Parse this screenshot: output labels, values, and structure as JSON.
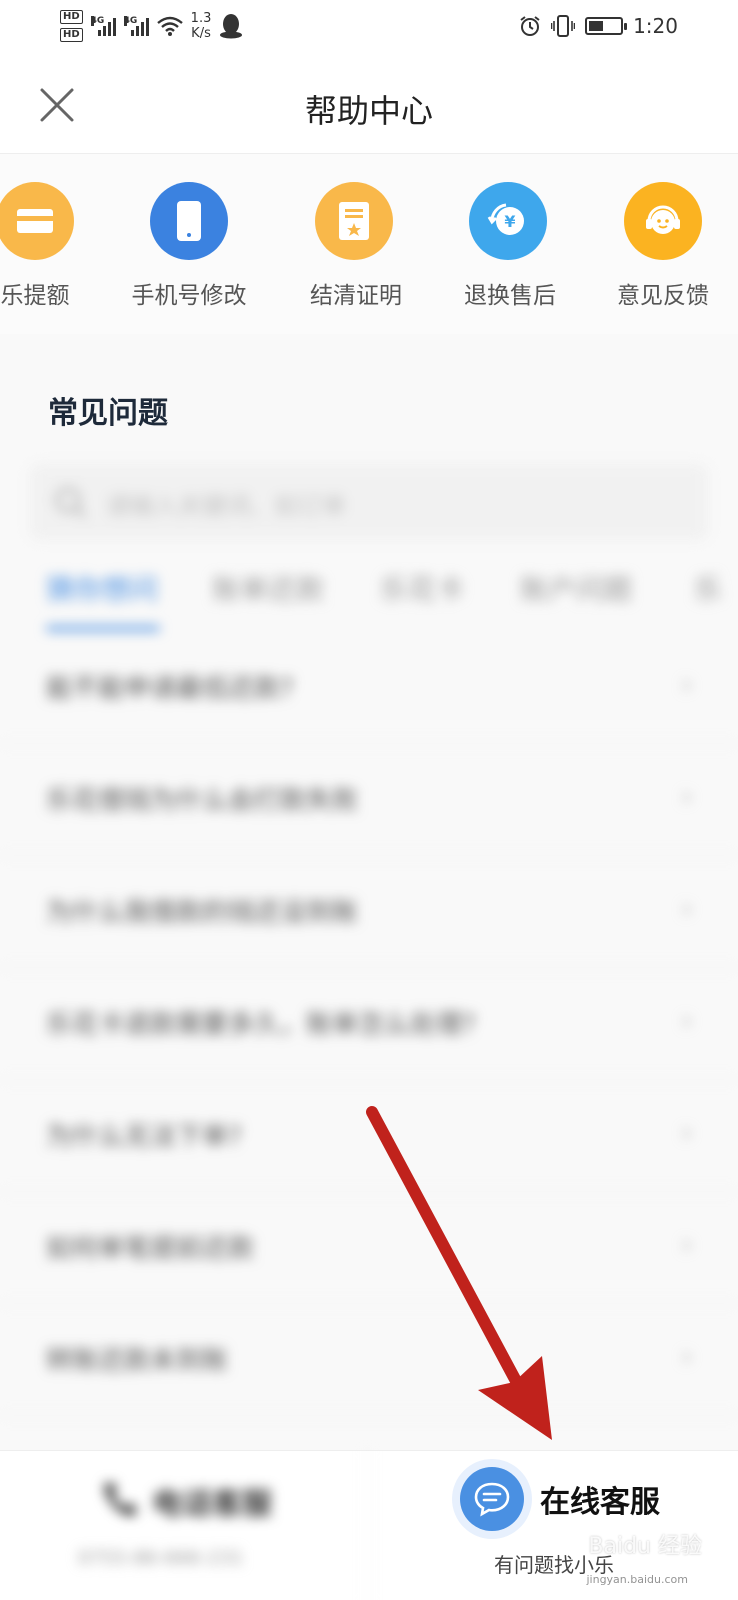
{
  "status_bar": {
    "hd1": "HD",
    "hd2": "HD",
    "sig1_tag": "4G",
    "sig2_tag": "4G",
    "net_speed_value": "1.3",
    "net_speed_unit": "K/s",
    "time": "1:20",
    "battery_level": 0.45
  },
  "header": {
    "title": "帮助中心"
  },
  "shortcuts": [
    {
      "label": "乐提额",
      "icon": "card-icon",
      "color": "#f9b84a"
    },
    {
      "label": "手机号修改",
      "icon": "phone-icon",
      "color": "#3b82e0"
    },
    {
      "label": "结清证明",
      "icon": "certificate-icon",
      "color": "#f9b84a"
    },
    {
      "label": "退换售后",
      "icon": "refund-icon",
      "color": "#3ea7ec"
    },
    {
      "label": "意见反馈",
      "icon": "headset-icon",
      "color": "#fbb321"
    }
  ],
  "faq": {
    "heading": "常见问题",
    "search_placeholder": "请输入关键词、如订单",
    "tabs": [
      "猜你想问",
      "账单还款",
      "乐花卡",
      "账户问题",
      "乐"
    ],
    "questions": [
      "能不能申请最低还款?",
      "乐花借钱为什么会打款失败",
      "为什么我借款的钱还没到账",
      "乐花卡退款需要多久，账单怎么处理?",
      "为什么无法下单?",
      "如何单笔提前还款",
      "转账还款未到账"
    ]
  },
  "bottom_bar": {
    "phone_label": "电话客服",
    "phone_number": "0755-86-666-231",
    "online_label": "在线客服",
    "online_sub": "有问题找小乐"
  },
  "watermark": {
    "text": "Baidu 经验",
    "url": "jingyan.baidu.com"
  },
  "colors": {
    "accent": "#4a90e2",
    "arrow": "#c0221c"
  }
}
